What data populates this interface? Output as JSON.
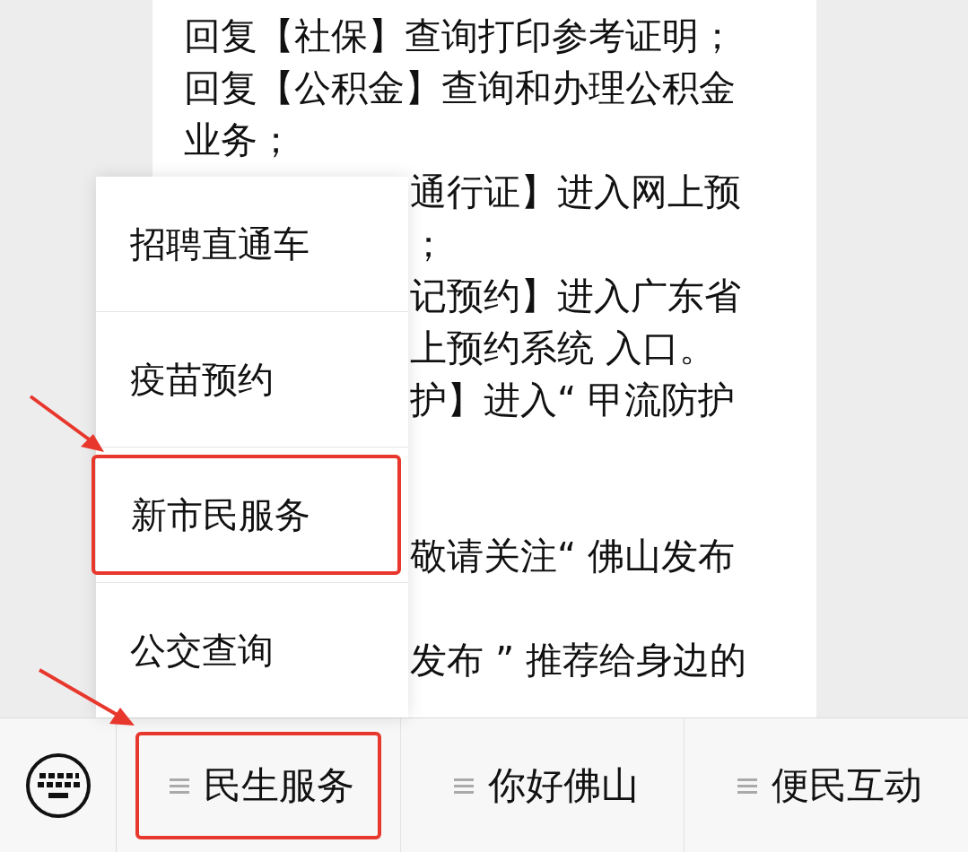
{
  "message": {
    "lines": [
      {
        "kind": "full",
        "text": "回复【社保】查询打印参考证明；"
      },
      {
        "kind": "full",
        "text": "回复【公积金】查询和办理公积金"
      },
      {
        "kind": "full",
        "text": "业务；"
      },
      {
        "kind": "partial",
        "text": "通行证】进入网上预"
      },
      {
        "kind": "partial",
        "text": "；"
      },
      {
        "kind": "partial",
        "text": "记预约】进入广东省"
      },
      {
        "kind": "partial",
        "text": "上预约系统  入口。"
      },
      {
        "kind": "partial",
        "text": "护】进入“ 甲流防护"
      },
      {
        "kind": "gap"
      },
      {
        "kind": "gap"
      },
      {
        "kind": "partial",
        "text": "敬请关注“ 佛山发布"
      },
      {
        "kind": "gap"
      },
      {
        "kind": "partial",
        "text": "发布 ” 推荐给身边的"
      }
    ]
  },
  "popup_menu": {
    "items": [
      {
        "label": "招聘直通车",
        "highlighted": false
      },
      {
        "label": "疫苗预约",
        "highlighted": false
      },
      {
        "label": "新市民服务",
        "highlighted": true
      },
      {
        "label": "公交查询",
        "highlighted": false
      }
    ]
  },
  "bottom_menu": [
    {
      "label": "民生服务",
      "highlighted": true
    },
    {
      "label": "你好佛山",
      "highlighted": false
    },
    {
      "label": "便民互动",
      "highlighted": false
    }
  ]
}
